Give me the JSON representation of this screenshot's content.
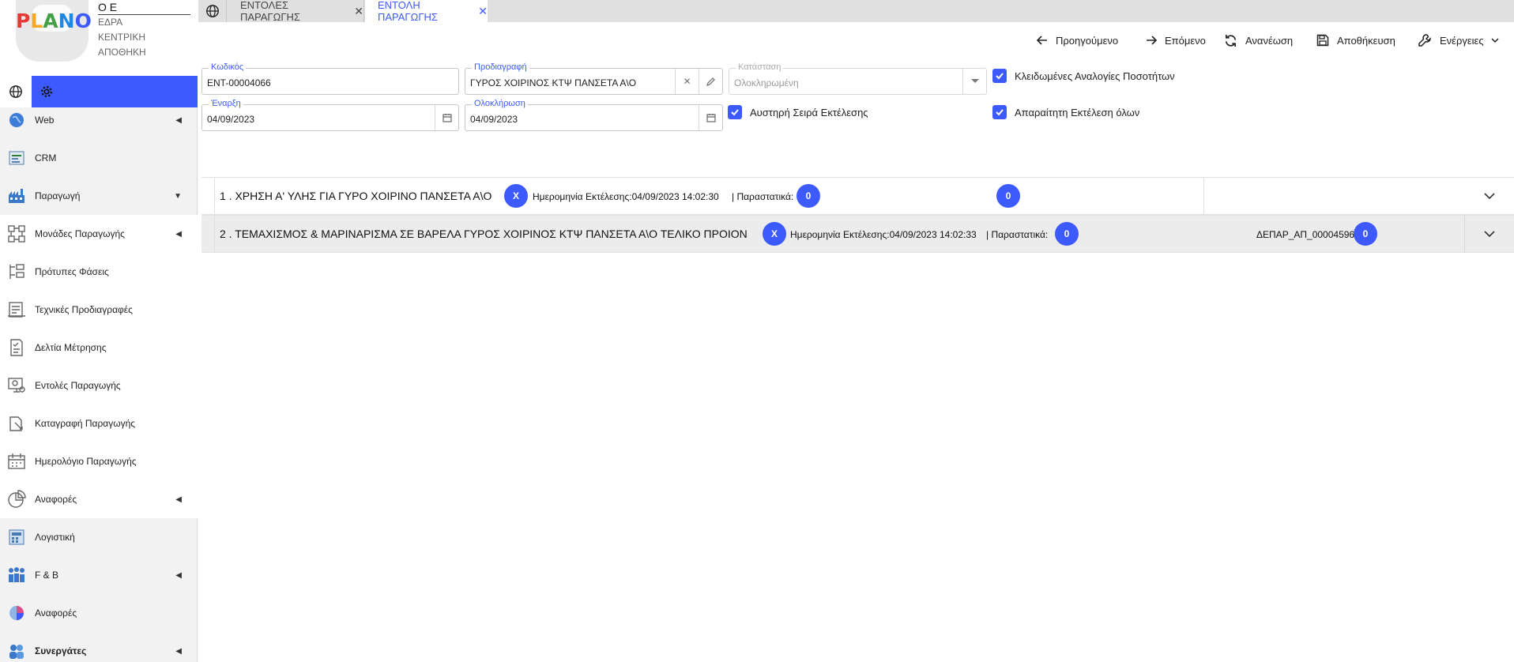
{
  "logo": {
    "letters": [
      "P",
      "L",
      "A",
      "N",
      "O"
    ],
    "colors": [
      "#e53935",
      "#f9a825",
      "#43a047",
      "#1e88e5",
      "#3d5afe"
    ]
  },
  "company": {
    "name": "Ο Ε",
    "lines": [
      "ΕΔΡΑ",
      "ΚΕΝΤΡΙΚΗ",
      "ΑΠΟΘΗΚΗ"
    ]
  },
  "sidebar": {
    "tools": {
      "globe_icon": "globe-icon",
      "settings_icon": "gear-icon"
    },
    "items": [
      {
        "label": "Web",
        "icon": "web-icon",
        "caret": "◀"
      },
      {
        "label": "CRM",
        "icon": "crm-icon",
        "caret": ""
      },
      {
        "label": "Παραγωγή",
        "icon": "production-icon",
        "caret": "▼"
      },
      {
        "label": "Μονάδες Παραγωγής",
        "icon": "production-units-icon",
        "caret": "◀"
      },
      {
        "label": "Πρότυπες Φάσεις",
        "icon": "template-phases-icon",
        "caret": ""
      },
      {
        "label": "Τεχνικές Προδιαγραφές",
        "icon": "technical-specs-icon",
        "caret": ""
      },
      {
        "label": "Δελτία Μέτρησης",
        "icon": "measurement-sheets-icon",
        "caret": ""
      },
      {
        "label": "Εντολές Παραγωγής",
        "icon": "production-orders-icon",
        "caret": ""
      },
      {
        "label": "Καταγραφή Παραγωγής",
        "icon": "production-recording-icon",
        "caret": ""
      },
      {
        "label": "Ημερολόγιο Παραγωγής",
        "icon": "production-calendar-icon",
        "caret": ""
      },
      {
        "label": "Αναφορές",
        "icon": "reports-icon",
        "caret": "◀"
      },
      {
        "label": "Λογιστική",
        "icon": "accounting-icon",
        "caret": ""
      },
      {
        "label": "F & B",
        "icon": "fnb-icon",
        "caret": "◀"
      },
      {
        "label": "Αναφορές",
        "icon": "reports-pie-icon",
        "caret": ""
      },
      {
        "label": "Συνεργάτες",
        "icon": "partners-icon",
        "caret": "◀"
      }
    ]
  },
  "tabs": [
    {
      "label": "",
      "icon": "globe-icon"
    },
    {
      "label": "ΕΝΤΟΛΕΣ ΠΑΡΑΓΩΓΗΣ",
      "close": "✕"
    },
    {
      "label": "ΕΝΤΟΛΗ ΠΑΡΑΓΩΓΗΣ",
      "close": "✕"
    }
  ],
  "toolbar": {
    "previous": "Προηγούμενο",
    "next": "Επόμενο",
    "refresh": "Ανανέωση",
    "save": "Αποθήκευση",
    "actions": "Ενέργειες"
  },
  "form": {
    "code": {
      "label": "Κωδικός",
      "value": "ENT-00004066"
    },
    "spec": {
      "label": "Προδιαγραφή",
      "value": "ΓΥΡΟΣ ΧΟΙΡΙΝΟΣ ΚΤΨ ΠΑΝΣΕΤΑ Α\\Ο"
    },
    "status": {
      "label": "Κατάσταση",
      "value": "Ολοκληρωμένη"
    },
    "start": {
      "label": "Έναρξη",
      "value": "04/09/2023"
    },
    "end": {
      "label": "Ολοκλήρωση",
      "value": "04/09/2023"
    },
    "locked_ratios": {
      "label": "Κλειδωμένες Αναλογίες Ποσοτήτων",
      "checked": true
    },
    "strict_order": {
      "label": "Αυστηρή Σειρά Εκτέλεσης",
      "checked": true
    },
    "require_all": {
      "label": "Απαραίτητη Εκτέλεση όλων",
      "checked": true
    }
  },
  "phases": [
    {
      "title": "1 . ΧΡΗΣΗ Α' ΥΛΗΣ ΓΙΑ ΓΥΡΟ ΧΟΙΡΙΝΟ ΠΑΝΣΕΤΑ Α\\Ο",
      "x_badge": "X",
      "executed": "Ημερομηνία Εκτέλεσης:04/09/2023 14:02:30",
      "docs_label": "| Παραστατικά:",
      "docs_badge": "0",
      "extra_doc": "",
      "extra_badge": "0"
    },
    {
      "title": "2 . ΤΕΜΑΧΙΣΜΟΣ & ΜΑΡΙΝΑΡΙΣΜΑ ΣΕ ΒΑΡΕΛΑ ΓΥΡΟΣ ΧΟΙΡΙΝΟΣ ΚΤΨ ΠΑΝΣΕΤΑ Α\\Ο ΤΕΛΙΚΟ ΠΡΟΙΟΝ",
      "x_badge": "X",
      "executed": "Ημερομηνία Εκτέλεσης:04/09/2023 14:02:33",
      "docs_label": "| Παραστατικά:",
      "docs_badge": "0",
      "extra_doc": "ΔΕΠΑΡ_ΑΠ_00004596",
      "extra_badge": "0"
    }
  ]
}
